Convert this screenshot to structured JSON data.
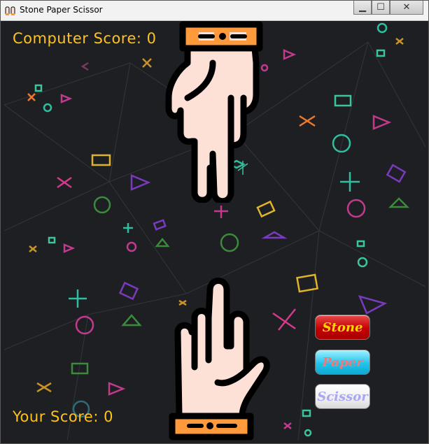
{
  "window": {
    "title": "Stone Paper Scissor",
    "minimize_glyph": "▁",
    "maximize_glyph": "☐",
    "close_glyph": "✕"
  },
  "scores": {
    "computer_label": "Computer Score: 0",
    "player_label": "Your Score: 0"
  },
  "hands": {
    "computer_choice": "scissor",
    "player_choice": "scissor",
    "skin_color": "#fde0d6",
    "cuff_color": "#ff9a3c",
    "outline_color": "#000000"
  },
  "buttons": {
    "stone_label": "Stone",
    "paper_label": "Paper",
    "scissor_label": "Scissor"
  },
  "colors": {
    "score_text": "#ffc21a",
    "background": "#1e1f22"
  }
}
